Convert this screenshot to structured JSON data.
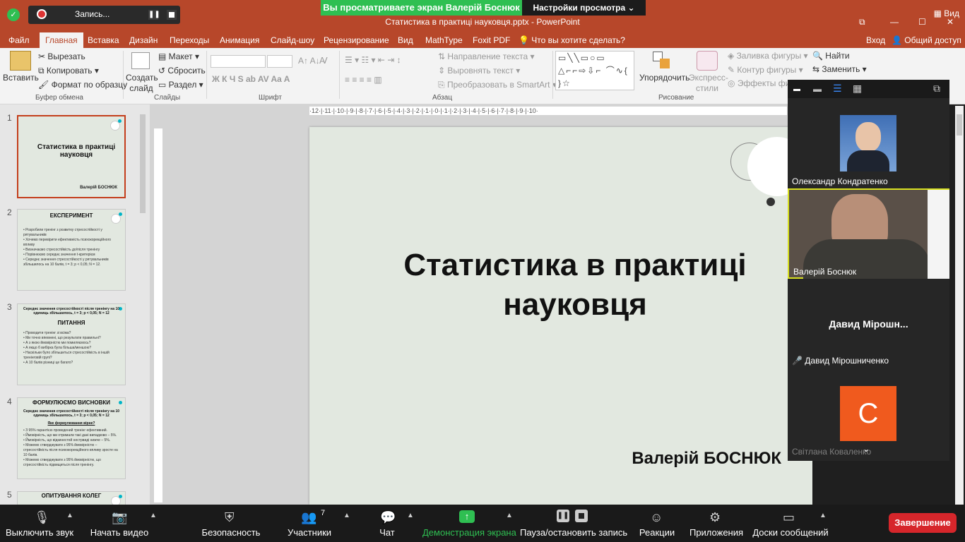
{
  "titlebar": {
    "title": "Статистика в практиці науковця.pptx - PowerPoint",
    "share_banner": "Вы просматриваете экран Валерій Боснюк",
    "view_settings": "Настройки просмотра",
    "recording_label": "Запись...",
    "view_label": "Вид"
  },
  "tabs": [
    "Файл",
    "Главная",
    "Вставка",
    "Дизайн",
    "Переходы",
    "Анимация",
    "Слайд-шоу",
    "Рецензирование",
    "Вид",
    "MathType",
    "Foxit PDF"
  ],
  "tell_me": "Что вы хотите сделать?",
  "account": {
    "signin": "Вход",
    "share": "Общий доступ"
  },
  "ribbon": {
    "paste": "Вставить",
    "cut": "Вырезать",
    "copy": "Копировать",
    "format_painter": "Формат по образцу",
    "clipboard_group": "Буфер обмена",
    "new_slide": "Создать слайд",
    "layout": "Макет",
    "reset": "Сбросить",
    "section": "Раздел",
    "slides_group": "Слайды",
    "font_group": "Шрифт",
    "text_direction": "Направление текста",
    "align_text": "Выровнять текст",
    "smartart": "Преобразовать в SmartArt",
    "paragraph_group": "Абзац",
    "arrange": "Упорядочить",
    "quick_styles": "Экспресс-стили",
    "shape_fill": "Заливка фигуры",
    "shape_outline": "Контур фигуры",
    "shape_effects": "Эффекты фигу",
    "drawing_group": "Рисование",
    "find": "Найти",
    "replace": "Заменить"
  },
  "thumbnails": [
    {
      "num": "1",
      "title": "Статистика в практиці науковця",
      "author": "Валерій БОСНЮК"
    },
    {
      "num": "2",
      "title": "ЕКСПЕРИМЕНТ",
      "bullets": [
        "• Розробили тренінг з розвитку стресостійкості у рятувальників",
        "• Хочемо перевірити ефективність психокорекційного впливу",
        "• Визначаємо стресостійкість до/після тренінгу",
        "• Порівнюємо середнє значення t-критерієм",
        "• Середнє значення стресостійкості у рятувальників збільшилось на 10 балів, t = 3; p < 0,05; N = 12."
      ]
    },
    {
      "num": "3",
      "title": "ПИТАННЯ",
      "subtitle": "Середнє значення стресостійкості після тренінгу на 10 одиниць збільшилось, t = 3; p < 0,05; N = 12",
      "bullets": [
        "• Проводити тренінг зі всіма?",
        "• Ми точно впевнені, що результати правильні?",
        "• А з якою ймовірністю ми помиляємось?",
        "• А якщо б вибірка була більша/меншою?",
        "• Наскільки було збільшиться стресостійкість в іншій тренінговій групі?",
        "• А 10 балів різниці це багато?"
      ]
    },
    {
      "num": "4",
      "title": "ФОРМУЛЮЄМО ВИСНОВКИ",
      "subtitle": "Середнє значення стресостійкості після тренінгу на 10 одиниць збільшилось, t = 3; p < 0,05; N = 12",
      "sub2": "Яке формулювання вірне?",
      "bullets": [
        "• З 95% гарантією проведений тренінг ефективний.",
        "• Ймовірність, що ми отримали такі дані випадково – 5%.",
        "• Ймовірність, що відкинестей нестрвиді нижче – 5%.",
        "• Можемо стверджувати з 95% ймовірністю – стресостійкість після психокорекційного впливу зросте на 10 балів.",
        "• Можемо стверджувати з 95% ймовірністю, що стресостійкість підвищиться після тренінгу."
      ]
    },
    {
      "num": "5",
      "title": "ОПИТУВАННЯ КОЛЕГ"
    }
  ],
  "ruler": "·12·|·11·|·10·|·9·|·8·|·7·|·6·|·5·|·4·|·3·|·2·|·1·|·0·|·1·|·2·|·3·|·4·|·5·|·6·|·7·|·8·|·9·|·10·",
  "slide": {
    "title_line1": "Статистика в практиці",
    "title_line2": "науковця",
    "author": "Валерій БОСНЮК"
  },
  "participants": [
    {
      "name": "Олександр Кондратенко"
    },
    {
      "name": "Валерій Боснюк"
    },
    {
      "name_short": "Давид  Мірошн...",
      "name": "Давид Мірошниченко"
    },
    {
      "initial": "С",
      "name": "Світлана Коваленко"
    }
  ],
  "toolbar": {
    "mute": "Выключить звук",
    "video": "Начать видео",
    "security": "Безопасность",
    "participants": "Участники",
    "participants_count": "7",
    "chat": "Чат",
    "share": "Демонстрация экрана",
    "pause_record": "Пауза/остановить запись",
    "reactions": "Реакции",
    "apps": "Приложения",
    "whiteboards": "Доски сообщений",
    "end": "Завершение"
  },
  "colors": {
    "accent": "#b7472a",
    "share_green": "#2fbf52",
    "end_red": "#d6262b",
    "active_speaker": "#d8e020",
    "avatar_orange": "#f05a1e"
  }
}
